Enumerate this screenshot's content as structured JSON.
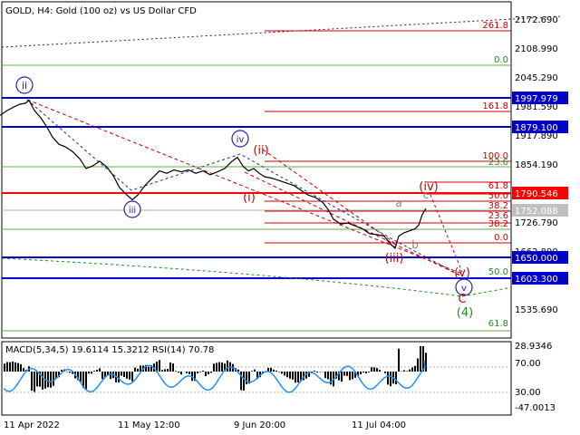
{
  "header": {
    "title": "GOLD, H4:  Gold (100 oz) vs US Dollar CFD"
  },
  "colors": {
    "price": "#000000",
    "blue_level": "#0000cc",
    "red_level": "#ff0000",
    "fib_red": "#cc0000",
    "fib_green": "#008000",
    "wave_blue": "#2222aa",
    "wave_red": "#cc0000",
    "wave_green": "#228b22",
    "wave_grey": "#808080",
    "macd_hist": "#000000",
    "rsi_line": "#1e90ff",
    "axis_text": "#000000"
  },
  "price_axis": {
    "ticks": [
      "2172.690",
      "2108.990",
      "2045.290",
      "1981.590",
      "1917.890",
      "1854.190",
      "1726.790",
      "1662.890",
      "1535.690"
    ],
    "level_tags": [
      {
        "text": "1997.979",
        "style": "blue"
      },
      {
        "text": "1879.100",
        "style": "blue"
      },
      {
        "text": "1790.546",
        "style": "red"
      },
      {
        "text": "1752.088",
        "style": "grey"
      },
      {
        "text": "1650.000",
        "style": "blue"
      },
      {
        "text": "1603.300",
        "style": "blue"
      }
    ]
  },
  "fib_labels": {
    "upper": [
      "261.8",
      "0.0",
      "161.8",
      "100.0",
      "23.6"
    ],
    "mid": [
      "61.8",
      "50.0",
      "38.2",
      "23.6",
      "38.2",
      "0.0"
    ],
    "lower": [
      "50.0",
      "61.8"
    ]
  },
  "wave_labels": {
    "ii": "ii",
    "iii": "iii",
    "iv": "iv",
    "v": "v",
    "ii_red": "(ii)",
    "i_red": "(i)",
    "iii_red": "(iii)",
    "iv_red": "(iv)",
    "v_red": "(v)",
    "a": "a",
    "b": "b",
    "c": "c",
    "C": "C",
    "four": "(4)"
  },
  "indicator": {
    "title": "MACD(5,34,5) 19.6114 15.3212 RSI(14) 70.78",
    "ticks": [
      "28.9346",
      "70.00",
      "30.00",
      "-47.0013"
    ]
  },
  "time_axis": {
    "labels": [
      "11 Apr 2022",
      "11 May 12:00",
      "9 Jun 20:00",
      "11 Jul 04:00"
    ]
  },
  "chart_data": {
    "type": "line",
    "title": "GOLD, H4:  Gold (100 oz) vs US Dollar CFD",
    "ylim": [
      1504,
      2200
    ],
    "price_path": [
      [
        0,
        1965
      ],
      [
        8,
        1975
      ],
      [
        15,
        1982
      ],
      [
        22,
        1988
      ],
      [
        28,
        1990
      ],
      [
        32,
        1996
      ],
      [
        38,
        1975
      ],
      [
        45,
        1960
      ],
      [
        52,
        1940
      ],
      [
        58,
        1920
      ],
      [
        65,
        1905
      ],
      [
        72,
        1900
      ],
      [
        80,
        1890
      ],
      [
        88,
        1875
      ],
      [
        95,
        1855
      ],
      [
        102,
        1860
      ],
      [
        110,
        1870
      ],
      [
        118,
        1858
      ],
      [
        125,
        1840
      ],
      [
        132,
        1815
      ],
      [
        140,
        1800
      ],
      [
        146,
        1790
      ],
      [
        152,
        1800
      ],
      [
        160,
        1820
      ],
      [
        168,
        1835
      ],
      [
        176,
        1850
      ],
      [
        184,
        1845
      ],
      [
        192,
        1852
      ],
      [
        200,
        1848
      ],
      [
        208,
        1852
      ],
      [
        216,
        1845
      ],
      [
        224,
        1850
      ],
      [
        232,
        1842
      ],
      [
        240,
        1848
      ],
      [
        248,
        1855
      ],
      [
        256,
        1870
      ],
      [
        262,
        1878
      ],
      [
        268,
        1860
      ],
      [
        274,
        1850
      ],
      [
        280,
        1855
      ],
      [
        286,
        1845
      ],
      [
        292,
        1838
      ],
      [
        300,
        1835
      ],
      [
        308,
        1830
      ],
      [
        316,
        1825
      ],
      [
        324,
        1820
      ],
      [
        332,
        1810
      ],
      [
        340,
        1800
      ],
      [
        348,
        1795
      ],
      [
        356,
        1785
      ],
      [
        362,
        1770
      ],
      [
        368,
        1750
      ],
      [
        376,
        1740
      ],
      [
        384,
        1742
      ],
      [
        392,
        1736
      ],
      [
        400,
        1730
      ],
      [
        408,
        1720
      ],
      [
        416,
        1718
      ],
      [
        424,
        1715
      ],
      [
        430,
        1700
      ],
      [
        436,
        1690
      ],
      [
        440,
        1715
      ],
      [
        446,
        1722
      ],
      [
        452,
        1726
      ],
      [
        458,
        1730
      ],
      [
        462,
        1738
      ],
      [
        466,
        1760
      ],
      [
        470,
        1772
      ]
    ],
    "levels": [
      1997.979,
      1879.1,
      1790.546,
      1752.088,
      1650.0,
      1603.3
    ],
    "macd": {
      "main": 19.6114,
      "signal": 15.3212
    },
    "rsi": 70.78
  }
}
